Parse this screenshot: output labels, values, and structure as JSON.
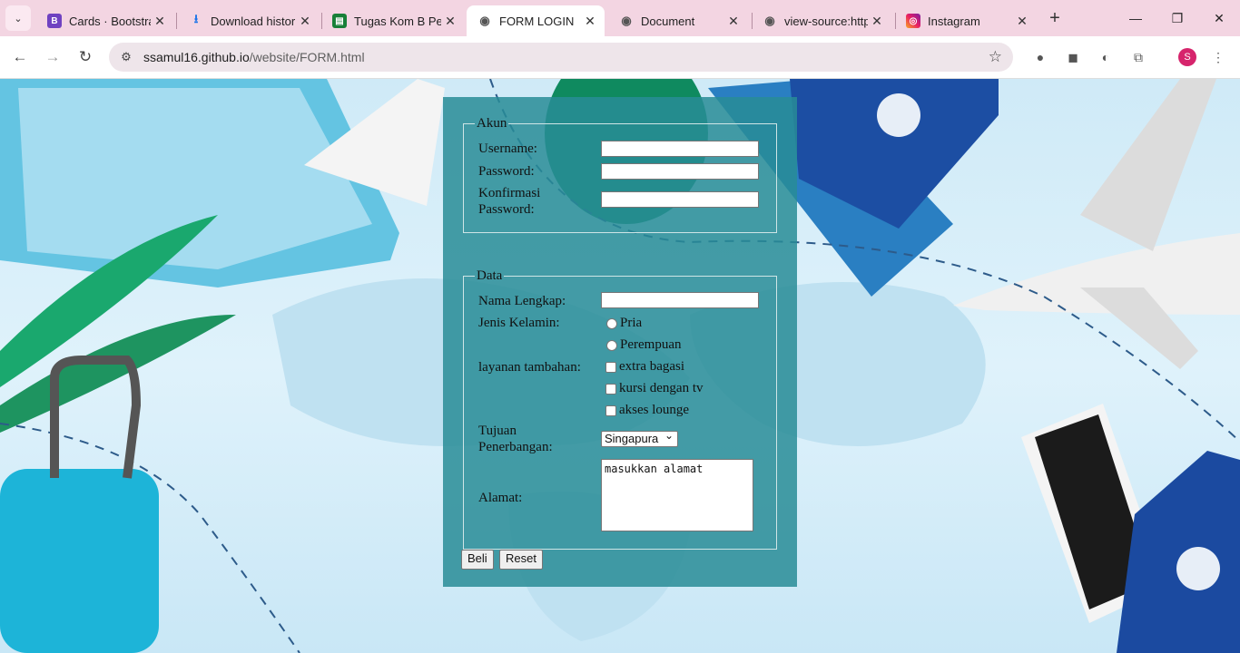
{
  "browser": {
    "tabs": [
      {
        "icon": "B",
        "title": "Cards · Bootstrap"
      },
      {
        "icon": "⭳",
        "title": "Download histor"
      },
      {
        "icon": "▤",
        "title": "Tugas Kom B Pe"
      },
      {
        "icon": "◉",
        "title": "FORM LOGIN"
      },
      {
        "icon": "◉",
        "title": "Document"
      },
      {
        "icon": "◉",
        "title": "view-source:http"
      },
      {
        "icon": "◎",
        "title": "Instagram"
      }
    ],
    "url_host": "ssamul16.github.io",
    "url_path": "/website/FORM.html",
    "profile_initial": "S"
  },
  "form": {
    "akun_legend": "Akun",
    "username_label": "Username:",
    "password_label": "Password:",
    "konfirmasi_label_1": "Konfirmasi",
    "konfirmasi_label_2": "Password:",
    "data_legend": "Data",
    "nama_label": "Nama Lengkap:",
    "jenis_label": "Jenis Kelamin:",
    "gender_options": [
      "Pria",
      "Perempuan"
    ],
    "layanan_label": "layanan tambahan:",
    "layanan_options": [
      "extra bagasi",
      "kursi dengan tv",
      "akses lounge"
    ],
    "tujuan_label_1": "Tujuan",
    "tujuan_label_2": "Penerbangan:",
    "tujuan_value": "Singapura",
    "alamat_label": "Alamat:",
    "alamat_value": "masukkan alamat",
    "beli_button": "Beli",
    "reset_button": "Reset"
  }
}
